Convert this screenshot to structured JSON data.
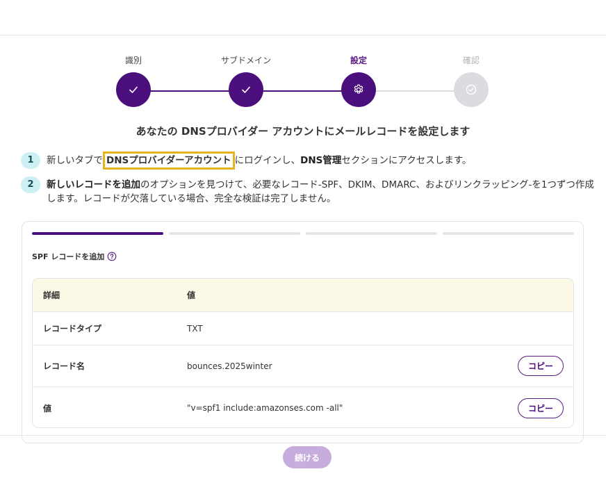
{
  "stepper": {
    "steps": [
      {
        "label": "識別",
        "state": "done"
      },
      {
        "label": "サブドメイン",
        "state": "done"
      },
      {
        "label": "設定",
        "state": "current"
      },
      {
        "label": "確認",
        "state": "pending"
      }
    ]
  },
  "heading": "あなたの DNSプロバイダー アカウントにメールレコードを設定します",
  "instructions": [
    {
      "number": "1",
      "pre": "新しいタブで",
      "highlight": "DNSプロバイダーアカウント",
      "mid": "にログインし、",
      "bold": "DNS管理",
      "post": "セクションにアクセスします。"
    },
    {
      "number": "2",
      "bold": "新しいレコードを追加",
      "post": "のオプションを見つけて、必要なレコード-SPF、DKIM、DMARC、およびリンクラッピング-を1つずつ作成します。レコードが欠落している場合、完全な検証は完了しません。"
    }
  ],
  "card": {
    "progress_segments": 4,
    "active_segment": 1,
    "title": "SPF レコードを追加",
    "table": {
      "header": {
        "key": "詳細",
        "value": "値"
      },
      "rows": [
        {
          "key": "レコードタイプ",
          "value": "TXT",
          "copy": false
        },
        {
          "key": "レコード名",
          "value": "bounces.2025winter",
          "copy": true
        },
        {
          "key": "値",
          "value": "\"v=spf1 include:amazonses.com -all\"",
          "copy": true
        }
      ],
      "copy_label": "コピー"
    }
  },
  "footer": {
    "continue_label": "続ける"
  },
  "colors": {
    "primary": "#4b0f7d",
    "pending": "#dcdbe0",
    "badge": "#cdf0f5",
    "highlight_border": "#e6b21e",
    "table_header": "#fcf8e6",
    "continue_disabled": "#c7addd"
  },
  "icons": {
    "done": "check-icon",
    "current": "gear-icon",
    "pending": "check-circle-icon",
    "help": "question-circle-icon"
  }
}
